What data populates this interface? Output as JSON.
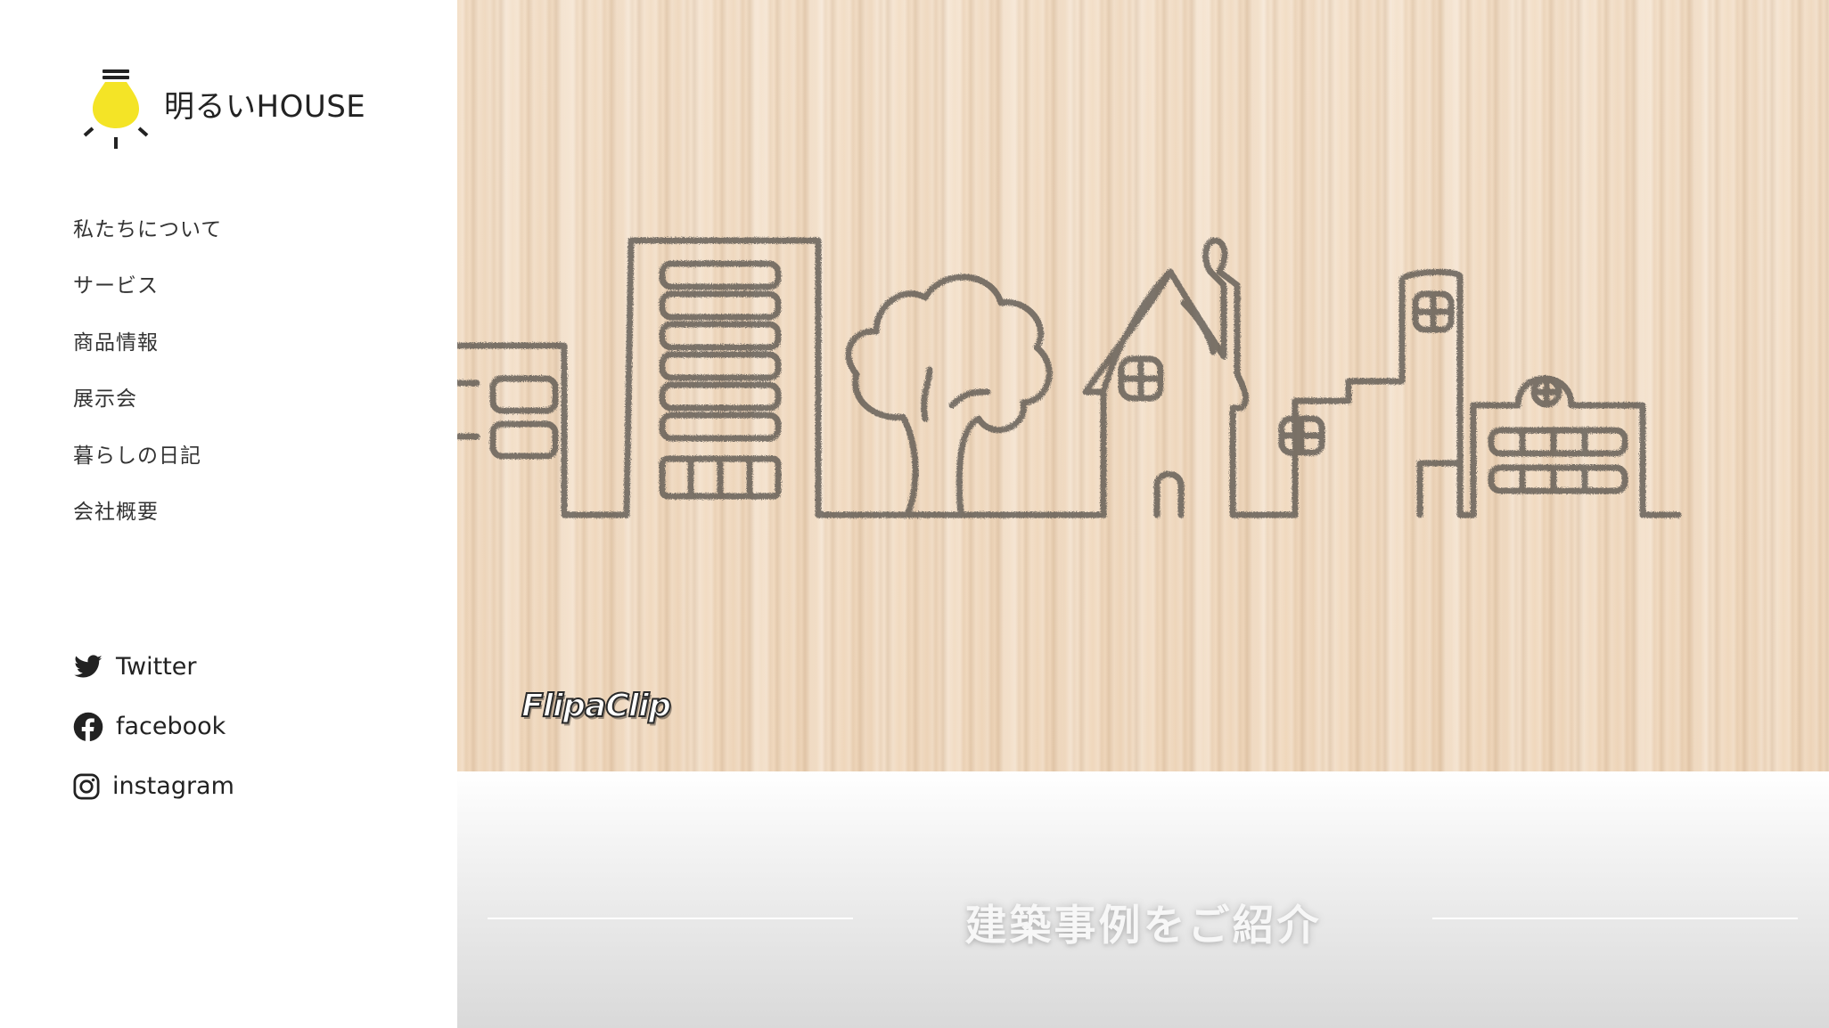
{
  "brand": {
    "name": "明るいHOUSE",
    "logo_icon": "lightbulb-icon",
    "logo_color": "#f4e426"
  },
  "nav": {
    "items": [
      {
        "label": "私たちについて"
      },
      {
        "label": "サービス"
      },
      {
        "label": "商品情報"
      },
      {
        "label": "展示会"
      },
      {
        "label": "暮らしの日記"
      },
      {
        "label": "会社概要"
      }
    ]
  },
  "social": {
    "items": [
      {
        "label": "Twitter",
        "icon": "twitter-icon"
      },
      {
        "label": "facebook",
        "icon": "facebook-icon"
      },
      {
        "label": "instagram",
        "icon": "instagram-icon"
      }
    ]
  },
  "hero": {
    "watermark": "FlipaClip"
  },
  "section": {
    "title": "建築事例をご紹介"
  }
}
